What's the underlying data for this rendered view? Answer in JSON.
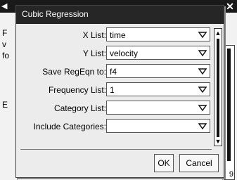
{
  "dialog": {
    "title": "Cubic Regression",
    "fields": [
      {
        "label": "X List:",
        "value": "time"
      },
      {
        "label": "Y List:",
        "value": "velocity"
      },
      {
        "label": "Save RegEqn to:",
        "value": "f4"
      },
      {
        "label": "Frequency List:",
        "value": "1"
      },
      {
        "label": "Category List:",
        "value": ""
      },
      {
        "label": "Include Categories:",
        "value": ""
      }
    ],
    "ok_label": "OK",
    "cancel_label": "Cancel"
  },
  "background": {
    "left_letters": [
      "F",
      "v",
      "fo",
      "E"
    ],
    "page_number": "9"
  },
  "icons": {
    "dropdown": "chevron-down-icon",
    "close": "close-icon"
  }
}
